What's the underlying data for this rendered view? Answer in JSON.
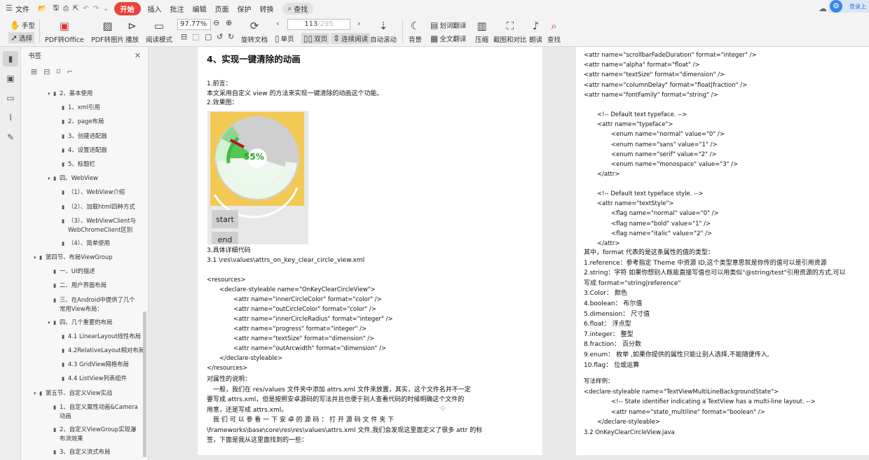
{
  "topbar": {
    "file": "文件",
    "menu_active": "开始",
    "menus": [
      "插入",
      "批注",
      "编辑",
      "页面",
      "保护",
      "转换"
    ],
    "search": "查找",
    "corner": "登录上"
  },
  "ribbon": {
    "hand": "手型",
    "select": "选择",
    "pdf_office": "PDF转Office",
    "pdf_image": "PDF转图片",
    "play": "播放",
    "read_mode": "阅读模式",
    "zoom": "97.77%",
    "page_current": "113",
    "page_total": "/295",
    "rotate": "旋转文档",
    "single": "单页",
    "double": "双页",
    "continuous": "连续阅读",
    "auto_scroll": "自动滚动",
    "background": "背景",
    "word_translate": "划词翻译",
    "full_translate": "全文翻译",
    "compress": "压缩",
    "screenshot": "截图和对比",
    "read_aloud": "朗读",
    "find": "查找"
  },
  "sidebar": {
    "title": "书签",
    "items": [
      {
        "t": "2、基本使用",
        "l": 2,
        "a": "▾"
      },
      {
        "t": "1、xml引用",
        "l": 3
      },
      {
        "t": "2、page布局",
        "l": 3
      },
      {
        "t": "3、创建适配器",
        "l": 3
      },
      {
        "t": "4、设置适配器",
        "l": 3
      },
      {
        "t": "5、标题栏",
        "l": 3
      },
      {
        "t": "四、WebView",
        "l": 2,
        "a": "▾"
      },
      {
        "t": "（1）、WebView介绍",
        "l": 3
      },
      {
        "t": "（2）、加载html四种方式",
        "l": 3
      },
      {
        "t": "（3）、WebViewClient与",
        "t2": "WebChromeClient区别",
        "l": 3
      },
      {
        "t": "（4）、简单使用",
        "l": 3
      },
      {
        "t": "第四节、布局ViewGroup",
        "l": 1,
        "a": "▾"
      },
      {
        "t": "一、UI的描述",
        "l": 2
      },
      {
        "t": "二、用户界面布局",
        "l": 2
      },
      {
        "t": "三、在Android中提供了几个",
        "t2": "常用View布局：",
        "l": 2
      },
      {
        "t": "四、几个重要的布局",
        "l": 2,
        "a": "▾"
      },
      {
        "t": "4.1 LinearLayout线性布局",
        "l": 3
      },
      {
        "t": "4.2RelativeLayout相对布局",
        "l": 3
      },
      {
        "t": "4.3 GridView网格布局",
        "l": 3
      },
      {
        "t": "4.4 ListView列表组件",
        "l": 3
      },
      {
        "t": "第五节、自定义View实战",
        "l": 1,
        "a": "▾"
      },
      {
        "t": "1、自定义属性动画&Camera",
        "t2": "动画",
        "l": 2
      },
      {
        "t": "2、自定义ViewGroup实现瀑",
        "t2": "布流效果",
        "l": 2
      },
      {
        "t": "3、自定义流式布局",
        "l": 2
      }
    ]
  },
  "page1": {
    "heading": "4、实现一键清除的动画",
    "intro": [
      "1.前言：",
      "本文采用自定义 view 的方法来实现一键清除的动画这个功能。",
      "2.效果图："
    ],
    "figure": {
      "percent": "55%",
      "start": "start",
      "end": "end"
    },
    "code_title": [
      "3.具体详细代码",
      "3.1 \\res\\values\\attrs_on_key_clear_circle_view.xml"
    ],
    "code": [
      "<resources>",
      "<declare-styleable name=\"OnKeyClearCircleView\">",
      "<attr name=\"innerCircleColor\" format=\"color\" />",
      "<attr name=\"outCircleColor\" format=\"color\" />",
      "<attr name=\"innerCircleRadius\" format=\"integer\" />",
      "<attr name=\"progress\" format=\"integer\" />",
      "<attr name=\"textSize\" format=\"dimension\" />",
      "<attr name=\"outArcwidth\" format=\"dimension\" />",
      "</declare-styleable>",
      "</resources>"
    ],
    "after": [
      "对属性的说明：",
      "一般，我们在 res/values 文件夹中添加 attrs.xml 文件来放置，其实，这个文件名并不一定",
      "要写成 attrs.xml，但是按照安卓源码的写法并且也便于别人查看代码的时候明确这个文件的",
      "用意，还是写成 attrs.xml。",
      "我 们 可 以 参 看 一 下 安 卓 的 源 码 ： 打 开 源 码 文 件 夹 下",
      "\\frameworks\\base\\core\\res\\res\\values\\attrs.xml 文件,我们会发现这里面定义了很多 attr 的标",
      "签，下面是我从这里面找到的一些："
    ]
  },
  "page2": {
    "top": [
      "<attr name=\"scrollbarFadeDuration\" format=\"integer\" />",
      "<attr name=\"alpha\" format=\"float\" />",
      "<attr name=\"textSize\" format=\"dimension\" />",
      "<attr name=\"columnDelay\" format=\"float|fraction\" />",
      "<attr name=\"fontFamily\" format=\"string\" />"
    ],
    "typeface": [
      "<!-- Default text typeface. -->",
      "<attr name=\"typeface\">",
      "<enum name=\"normal\" value=\"0\" />",
      "<enum name=\"sans\" value=\"1\" />",
      "<enum name=\"serif\" value=\"2\" />",
      "<enum name=\"monospace\" value=\"3\" />",
      "</attr>"
    ],
    "style": [
      "<!-- Default text typeface style. -->",
      "<attr name=\"textStyle\">",
      "<flag name=\"normal\" value=\"0\" />",
      "<flag name=\"bold\" value=\"1\" />",
      "<flag name=\"italic\" value=\"2\" />",
      "</attr>"
    ],
    "types": [
      "其中，format 代表的是这条属性的值的类型：",
      "1.reference：参考指定 Theme 中资源 ID,这个类型意思就是你传的值可以是引用资源",
      "2.string：字符 如果你想别人既能直接写值也可以用类似\"@string/test\"引用资源的方式,可以",
      "写成 format=\"string|reference\"",
      "3.Color： 颜色",
      "4.boolean： 布尔值",
      "5.dimension： 尺寸值",
      "6.float： 浮点型",
      "7.integer： 整型",
      "8.fraction： 百分数",
      "9.enum： 枚举 ,如果你提供的属性只能让别人选择,不能随便传入,",
      "10.flag： 位或运算"
    ],
    "sample": [
      "写法样例：",
      "<declare-styleable name=\"TextViewMultiLineBackgroundState\">",
      "<!-- State identifier indicating a TextView has a multi-line layout. -->",
      "<attr name=\"state_multiline\" format=\"boolean\" />",
      "</declare-styleable>",
      "3.2 OnKeyClearCircleView.java"
    ]
  }
}
